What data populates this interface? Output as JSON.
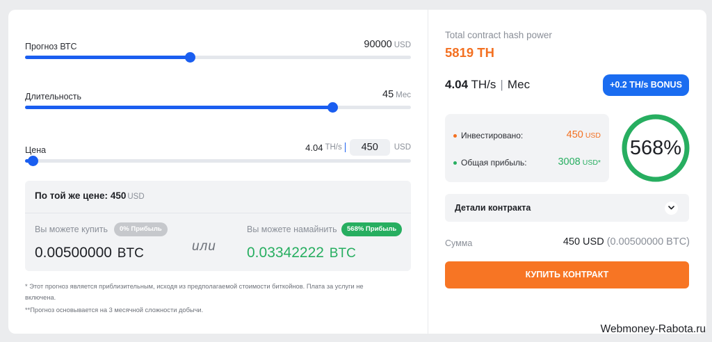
{
  "forecast": {
    "label": "Прогноз ВТС",
    "value": "90000",
    "unit": "USD",
    "fill_percent": 42.7
  },
  "duration": {
    "label": "Длительность",
    "value": "45",
    "unit": "Мес",
    "fill_percent": 79.7
  },
  "price": {
    "label": "Цена",
    "ths_value": "4.04",
    "ths_unit": "TH/s",
    "input_value": "450",
    "unit": "USD",
    "fill_percent": 2
  },
  "compare": {
    "head_label": "По той же цене:",
    "head_value": "450",
    "head_unit": "USD",
    "buy_label": "Вы можете купить",
    "buy_badge": "0% Прибыль",
    "buy_value": "0.00500000",
    "buy_unit": "BTC",
    "or_label": "или",
    "mine_label": "Вы можете намайнить",
    "mine_badge": "568% Прибыль",
    "mine_value": "0.03342222",
    "mine_unit": "BTC"
  },
  "notes": {
    "note1": "* Этот прогноз является приблизительным, исходя из предполагаемой стоимости биткойнов. Плата за услуги не включена.",
    "note2": "**Прогноз основывается на 3 месячной сложности добычи."
  },
  "summary": {
    "title": "Total contract hash power",
    "hash_power": "5819 TH",
    "rate_value": "4.04",
    "rate_unit": "TH/s",
    "rate_sep": "|",
    "rate_period": "Мес",
    "bonus": "+0.2 TH/s BONUS"
  },
  "stats": {
    "invested_label": "Инвестировано:",
    "invested_value": "450",
    "invested_unit": "USD",
    "profit_label": "Общая прибыль:",
    "profit_value": "3008",
    "profit_unit": "USD*",
    "ring_value": "568%",
    "ring_fill_percent": 100
  },
  "details": {
    "label": "Детали контракта"
  },
  "sum": {
    "label": "Сумма",
    "value": "450 USD",
    "sub": "(0.00500000 BTC)"
  },
  "buy_button": {
    "label": "КУПИТЬ КОНТРАКТ"
  },
  "watermark": "Webmoney-Rabota.ru",
  "colors": {
    "accent_blue": "#1a5ef0",
    "accent_orange": "#f37021",
    "profit_green": "#27ae60",
    "invest_dot": "#f37021",
    "profit_dot": "#27ae60"
  },
  "icons": {
    "chevron": "chevron-down-icon"
  }
}
